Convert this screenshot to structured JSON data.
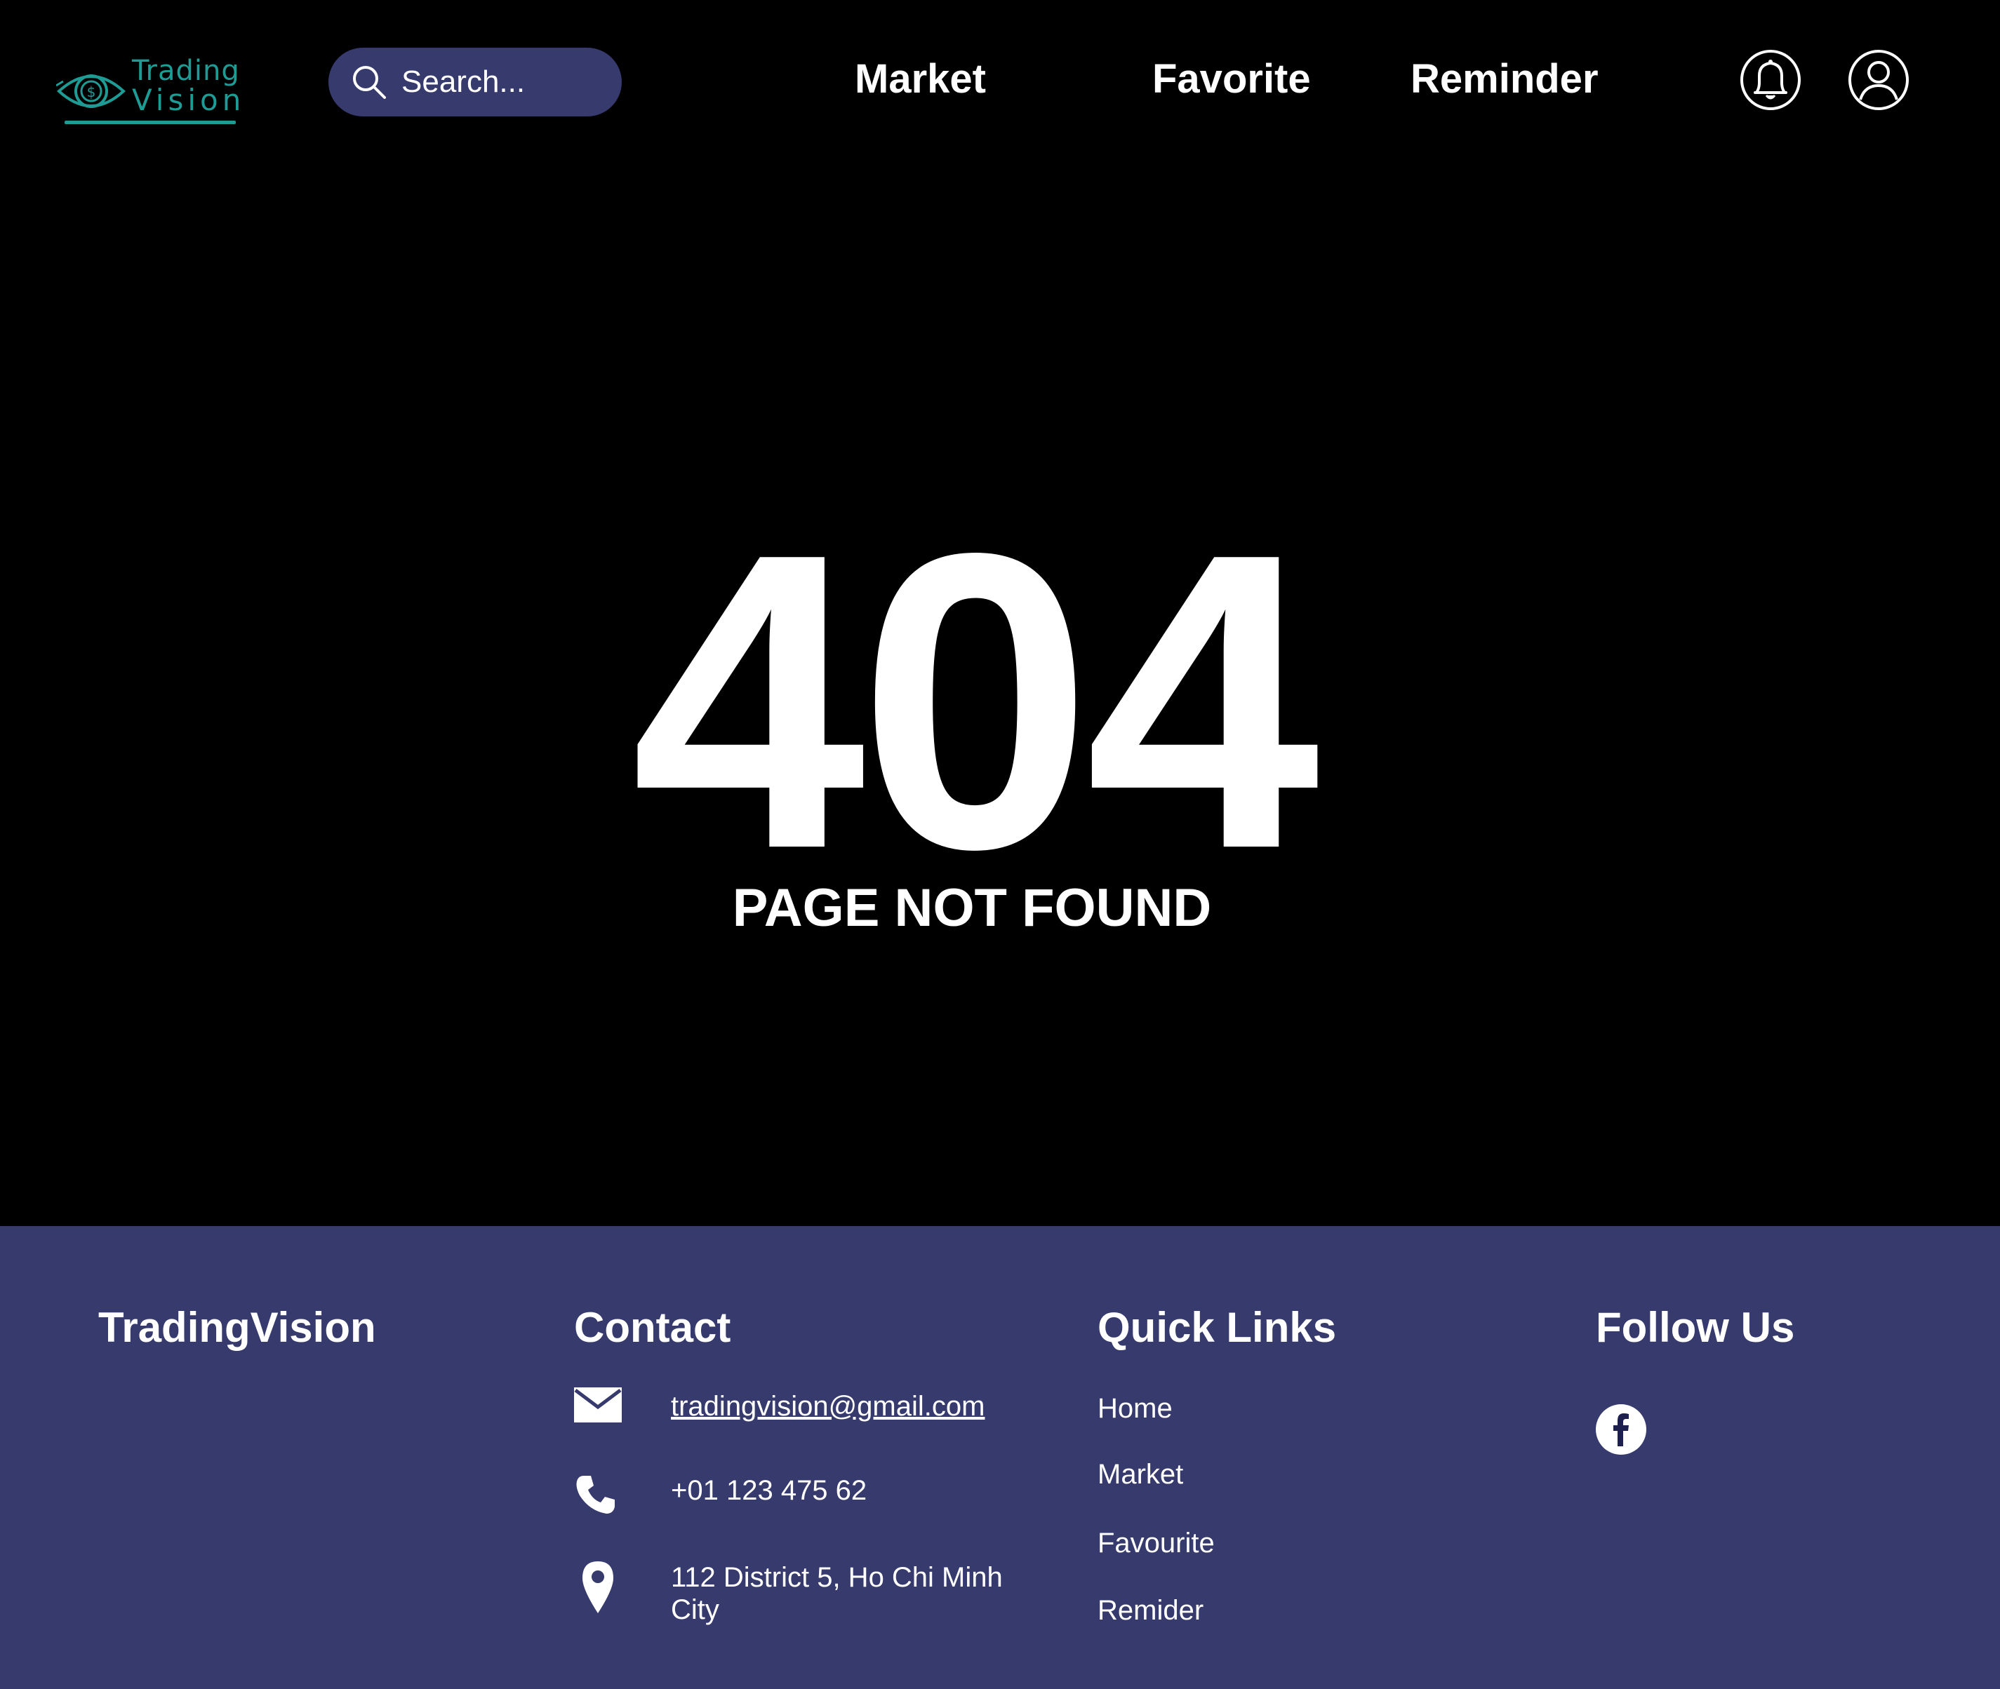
{
  "header": {
    "logo": {
      "line1": "Trading",
      "line2": "Vision",
      "color": "#1f9b95"
    },
    "search": {
      "placeholder": "Search..."
    },
    "nav": [
      {
        "label": "Market"
      },
      {
        "label": "Favorite"
      },
      {
        "label": "Reminder"
      }
    ],
    "icons": {
      "notifications": "bell-icon",
      "account": "user-icon"
    }
  },
  "main": {
    "code": "404",
    "message": "PAGE NOT FOUND"
  },
  "footer": {
    "brand": "TradingVision",
    "contact": {
      "heading": "Contact",
      "email": "tradingvision@gmail.com",
      "phone": "+01 123 475 62",
      "address_line1": "112 District 5, Ho Chi Minh",
      "address_line2": "City"
    },
    "quick_links": {
      "heading": "Quick Links",
      "items": [
        "Home",
        "Market",
        "Favourite",
        "Remider"
      ]
    },
    "follow": {
      "heading": "Follow Us",
      "icon": "facebook-icon"
    }
  },
  "colors": {
    "background": "#000000",
    "footer": "#373a6c",
    "search_bg": "#373a6c",
    "accent": "#1f9b95",
    "text": "#ffffff"
  }
}
